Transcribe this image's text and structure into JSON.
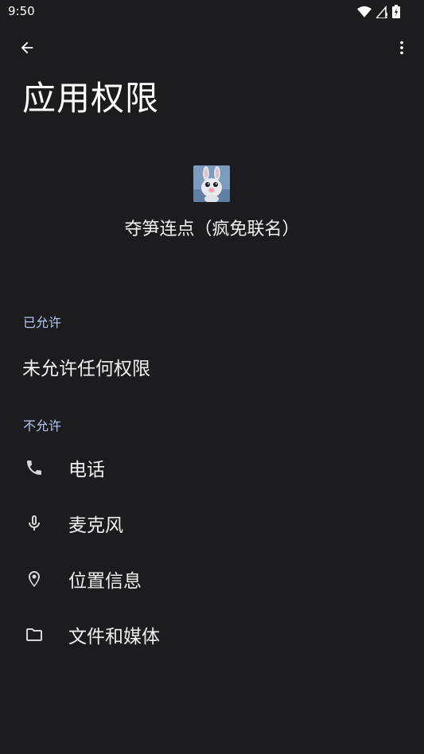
{
  "status_bar": {
    "time": "9:50"
  },
  "header": {
    "title": "应用权限"
  },
  "app": {
    "name": "夺笋连点（疯免联名）"
  },
  "allowed": {
    "header": "已允许",
    "empty_text": "未允许任何权限"
  },
  "denied": {
    "header": "不允许",
    "items": [
      {
        "label": "电话",
        "icon": "phone-icon"
      },
      {
        "label": "麦克风",
        "icon": "microphone-icon"
      },
      {
        "label": "位置信息",
        "icon": "location-icon"
      },
      {
        "label": "文件和媒体",
        "icon": "folder-icon"
      }
    ]
  },
  "colors": {
    "background": "#1c1c1e",
    "section_header": "#b4c6f5",
    "text": "#f0f0f0"
  }
}
